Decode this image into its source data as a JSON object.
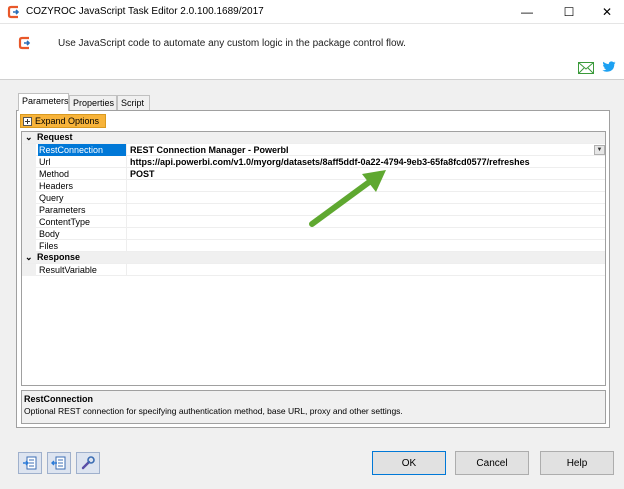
{
  "window": {
    "title": "COZYROC JavaScript Task Editor 2.0.100.1689/2017",
    "minimize_glyph": "—",
    "maximize_glyph": "☐",
    "close_glyph": "✕"
  },
  "header": {
    "description": "Use JavaScript code to automate any custom logic in the package control flow."
  },
  "tabs": [
    {
      "label": "Parameters",
      "active": true
    },
    {
      "label": "Properties",
      "active": false
    },
    {
      "label": "Script",
      "active": false
    }
  ],
  "expand_options": {
    "label": "Expand Options"
  },
  "grid": {
    "categories": [
      {
        "label": "Request",
        "toggle": "⌄",
        "rows": [
          {
            "name": "RestConnection",
            "value": "REST Connection Manager  - PowerbI",
            "selected": true
          },
          {
            "name": "Url",
            "value": "https://api.powerbi.com/v1.0/myorg/datasets/8aff5ddf-0a22-4794-9eb3-65fa8fcd0577/refreshes"
          },
          {
            "name": "Method",
            "value": "POST"
          },
          {
            "name": "Headers",
            "value": ""
          },
          {
            "name": "Query",
            "value": ""
          },
          {
            "name": "Parameters",
            "value": ""
          },
          {
            "name": "ContentType",
            "value": ""
          },
          {
            "name": "Body",
            "value": ""
          },
          {
            "name": "Files",
            "value": ""
          }
        ]
      },
      {
        "label": "Response",
        "toggle": "⌄",
        "rows": [
          {
            "name": "ResultVariable",
            "value": ""
          }
        ]
      }
    ]
  },
  "description": {
    "title": "RestConnection",
    "text": "Optional REST connection for specifying authentication method, base URL, proxy and other settings."
  },
  "buttons": {
    "ok": "OK",
    "cancel": "Cancel",
    "help": "Help"
  },
  "colors": {
    "accent": "#0078d7",
    "expand_button": "#f7b33a",
    "arrow": "#5fa830"
  }
}
